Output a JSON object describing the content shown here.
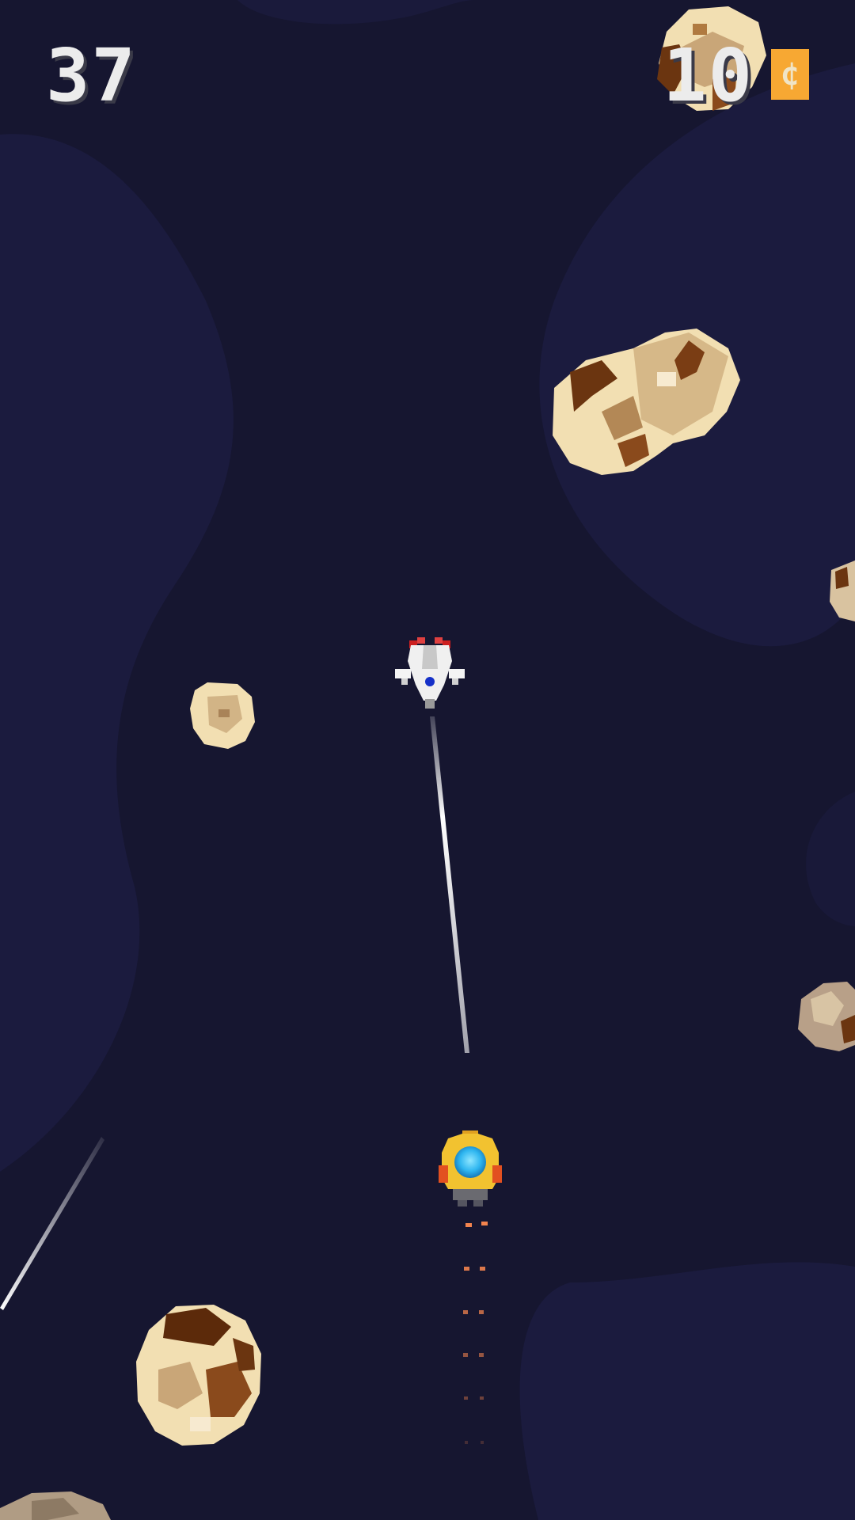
{
  "hud": {
    "score": "37",
    "coins": "10",
    "coin_symbol": "¢",
    "coin_color": "#f7a833"
  },
  "colors": {
    "space": "#161630",
    "nebula": "#1b1b3e",
    "asteroid_light": "#f2dfb2",
    "asteroid_mid": "#c9a678",
    "asteroid_dark": "#6b3510",
    "laser": "#ffffff",
    "player_core": "#2fb6f0"
  },
  "icons": {
    "coin": "coin-icon",
    "player": "player-ship-icon",
    "enemy": "enemy-ship-icon",
    "asteroid": "asteroid-icon"
  }
}
